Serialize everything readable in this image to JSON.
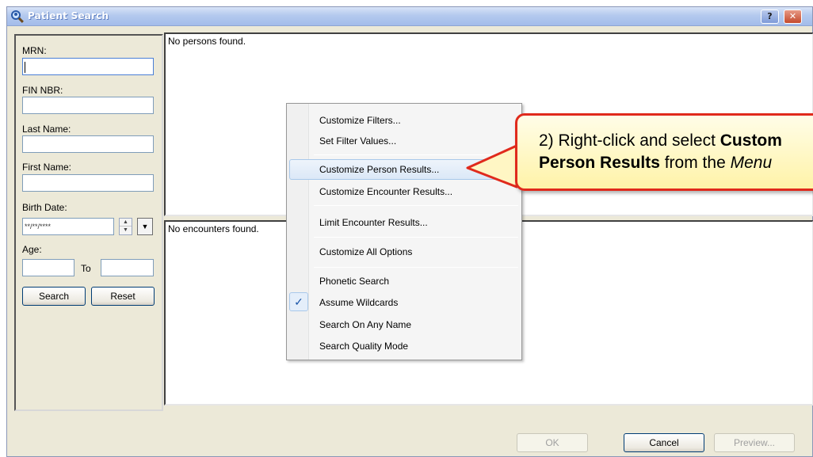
{
  "window": {
    "title": "Patient Search",
    "help_label": "?",
    "close_label": "✕"
  },
  "search_form": {
    "mrn_label": "MRN:",
    "fin_label": "FIN NBR:",
    "last_name_label": "Last Name:",
    "first_name_label": "First Name:",
    "birth_date_label": "Birth Date:",
    "birth_date_placeholder": "**/**/****",
    "age_label": "Age:",
    "age_to_label": "To",
    "search_button": "Search",
    "reset_button": "Reset"
  },
  "results": {
    "persons_empty": "No persons found.",
    "encounters_empty": "No encounters found."
  },
  "context_menu": {
    "items": [
      {
        "label": "Customize Filters..."
      },
      {
        "label": "Set Filter Values..."
      },
      {
        "label": "Customize Person Results..."
      },
      {
        "label": "Customize Encounter Results..."
      },
      {
        "label": "Limit Encounter Results..."
      },
      {
        "label": "Customize All Options"
      },
      {
        "label": "Phonetic Search"
      },
      {
        "label": "Assume Wildcards",
        "checked": true
      },
      {
        "label": "Search On Any Name"
      },
      {
        "label": "Search Quality Mode"
      }
    ],
    "check_mark": "✓"
  },
  "callout": {
    "prefix": "2) Right-click and select ",
    "bold_1": "Custom",
    "bold_2": "Person Results",
    "mid": " from the ",
    "italic": "Menu"
  },
  "footer": {
    "ok_button": "OK",
    "cancel_button": "Cancel",
    "preview_button": "Preview..."
  },
  "colors": {
    "callout_border": "#e02a1c",
    "callout_fill": "#fff3a8",
    "title_bar": "#a3bcea"
  }
}
